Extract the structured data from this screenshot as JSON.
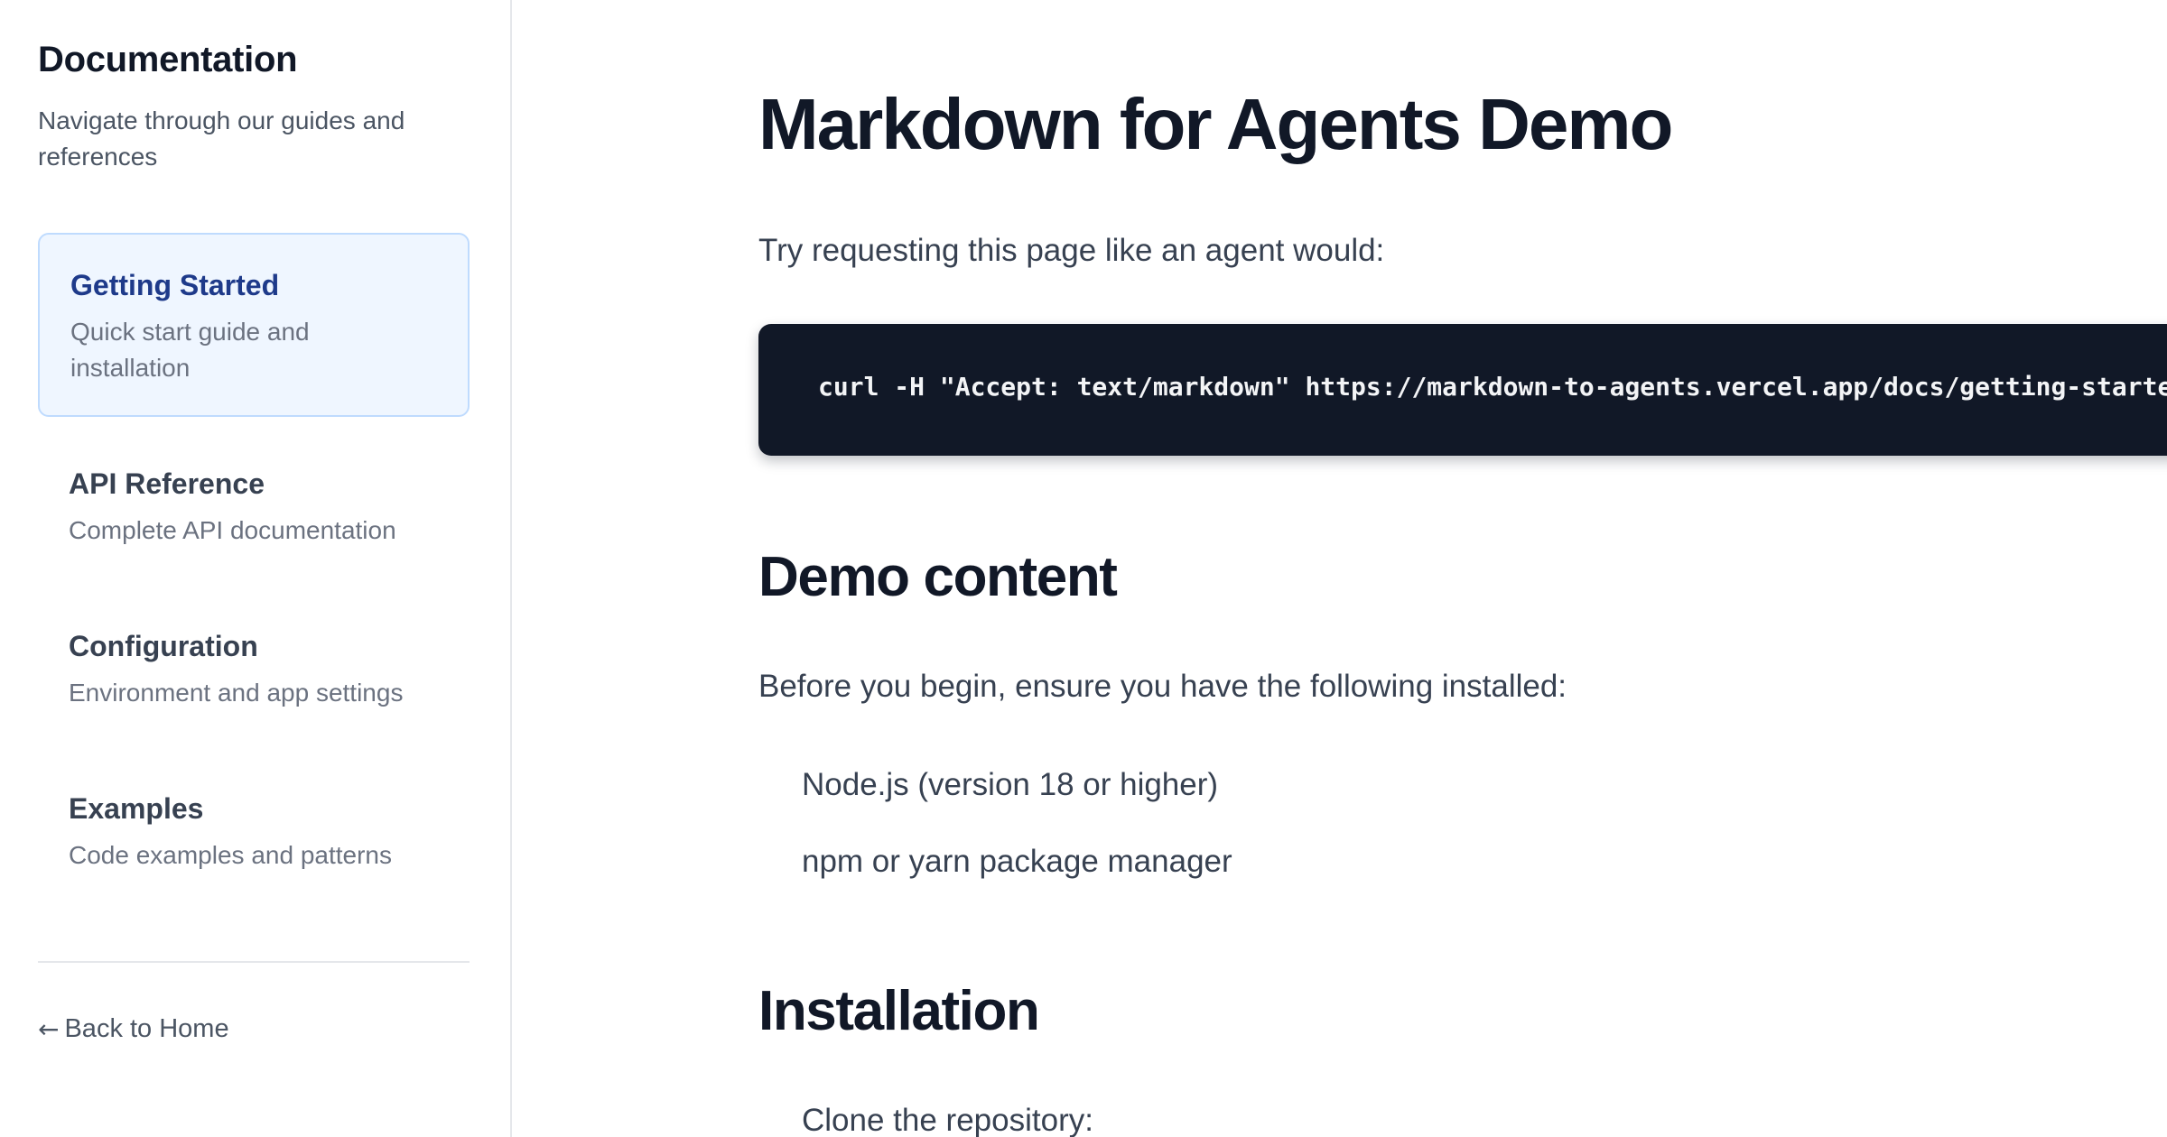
{
  "sidebar": {
    "title": "Documentation",
    "subtitle": "Navigate through our guides and references",
    "items": [
      {
        "label": "Getting Started",
        "description": "Quick start guide and installation",
        "active": true
      },
      {
        "label": "API Reference",
        "description": "Complete API documentation",
        "active": false
      },
      {
        "label": "Configuration",
        "description": "Environment and app settings",
        "active": false
      },
      {
        "label": "Examples",
        "description": "Code examples and patterns",
        "active": false
      }
    ],
    "back_link": {
      "icon": "arrow-left-icon",
      "arrow": "←",
      "label": "Back to Home"
    }
  },
  "main": {
    "title": "Markdown for Agents Demo",
    "intro": "Try requesting this page like an agent would:",
    "code": "curl -H \"Accept: text/markdown\" https://markdown-to-agents.vercel.app/docs/getting-started",
    "sections": [
      {
        "heading": "Demo content",
        "paragraph": "Before you begin, ensure you have the following installed:",
        "items": [
          "Node.js (version 18 or higher)",
          "npm or yarn package manager"
        ]
      },
      {
        "heading": "Installation",
        "items": [
          "Clone the repository:"
        ]
      }
    ]
  },
  "colors": {
    "active_bg": "#eff6ff",
    "active_border": "#bfdbfe",
    "active_text": "#1e3a8a",
    "code_bg": "#111827",
    "heading": "#111827"
  }
}
